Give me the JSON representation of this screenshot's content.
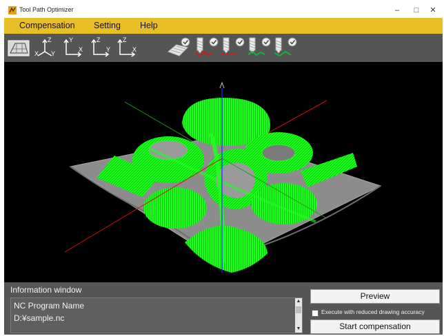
{
  "window": {
    "title": "Tool Path Optimizer"
  },
  "menu": {
    "items": [
      "Compensation",
      "Setting",
      "Help"
    ]
  },
  "toolbar": {
    "view_buttons": [
      {
        "icon": "iso-view-icon"
      },
      {
        "icon": "axis-xyz-view-icon",
        "axes": [
          "Z",
          "X",
          "Y"
        ]
      },
      {
        "icon": "axis-xy-view-icon",
        "axes": [
          "Y",
          "X"
        ]
      },
      {
        "icon": "axis-zy-view-icon",
        "axes": [
          "Z",
          "Y"
        ]
      },
      {
        "icon": "axis-zx-view-icon",
        "axes": [
          "Z",
          "X"
        ]
      }
    ],
    "toggle_buttons": [
      {
        "icon": "surface-toggle-icon",
        "checked": true
      },
      {
        "icon": "tool-path-red-icon",
        "checked": true
      },
      {
        "icon": "tool-path-red-dashed-icon",
        "checked": true
      },
      {
        "icon": "tool-path-green-icon",
        "checked": true
      },
      {
        "icon": "tool-path-green-solid-icon",
        "checked": true
      }
    ],
    "colors": {
      "bg": "#555555",
      "red": "#d11a1a",
      "green": "#12b43a"
    }
  },
  "viewport": {
    "background": "#000000",
    "surface_color": "#8a8a8a",
    "path_color": "#1fff1f",
    "axis_colors": {
      "x": "#d01010",
      "y": "#1a9a1a",
      "z": "#2a2aff"
    }
  },
  "info": {
    "title": "Information window",
    "lines": [
      "NC Program Name",
      "D:¥sample.nc"
    ]
  },
  "actions": {
    "preview_label": "Preview",
    "reduced_accuracy_label": "Execute with reduced drawing accuracy",
    "reduced_accuracy_checked": false,
    "start_label": "Start compensation"
  },
  "theme": {
    "menu_bar": "#e9bf27",
    "panel": "#555555"
  }
}
